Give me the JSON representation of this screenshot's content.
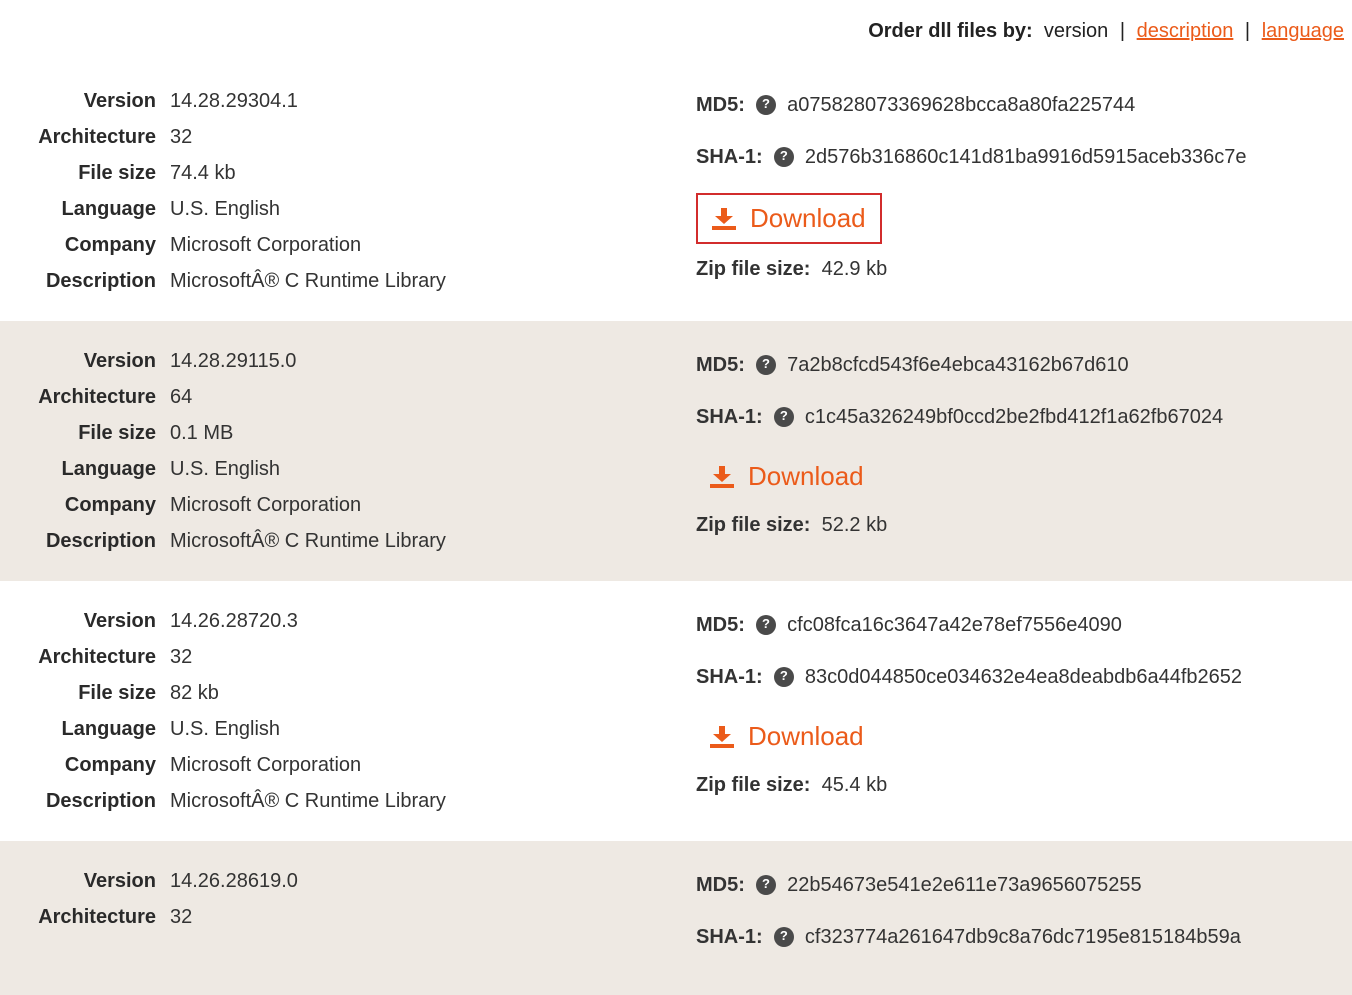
{
  "sort": {
    "label": "Order dll files by:",
    "options": [
      "version",
      "description",
      "language"
    ],
    "active": "version"
  },
  "labels": {
    "version": "Version",
    "architecture": "Architecture",
    "filesize": "File size",
    "language": "Language",
    "company": "Company",
    "description": "Description",
    "md5": "MD5:",
    "sha1": "SHA-1:",
    "download": "Download",
    "zip": "Zip file size:"
  },
  "files": [
    {
      "version": "14.28.29304.1",
      "architecture": "32",
      "filesize": "74.4 kb",
      "language": "U.S. English",
      "company": "Microsoft Corporation",
      "description": "MicrosoftÂ® C Runtime Library",
      "md5": "a075828073369628bcca8a80fa225744",
      "sha1": "2d576b316860c141d81ba9916d5915aceb336c7e",
      "zip": "42.9 kb",
      "highlight": true
    },
    {
      "version": "14.28.29115.0",
      "architecture": "64",
      "filesize": "0.1 MB",
      "language": "U.S. English",
      "company": "Microsoft Corporation",
      "description": "MicrosoftÂ® C Runtime Library",
      "md5": "7a2b8cfcd543f6e4ebca43162b67d610",
      "sha1": "c1c45a326249bf0ccd2be2fbd412f1a62fb67024",
      "zip": "52.2 kb",
      "highlight": false
    },
    {
      "version": "14.26.28720.3",
      "architecture": "32",
      "filesize": "82 kb",
      "language": "U.S. English",
      "company": "Microsoft Corporation",
      "description": "MicrosoftÂ® C Runtime Library",
      "md5": "cfc08fca16c3647a42e78ef7556e4090",
      "sha1": "83c0d044850ce034632e4ea8deabdb6a44fb2652",
      "zip": "45.4 kb",
      "highlight": false
    },
    {
      "version": "14.26.28619.0",
      "architecture": "32",
      "filesize": "",
      "language": "",
      "company": "",
      "description": "",
      "md5": "22b54673e541e2e611e73a9656075255",
      "sha1": "cf323774a261647db9c8a76dc7195e815184b59a",
      "zip": "",
      "highlight": false,
      "partial": true
    }
  ]
}
